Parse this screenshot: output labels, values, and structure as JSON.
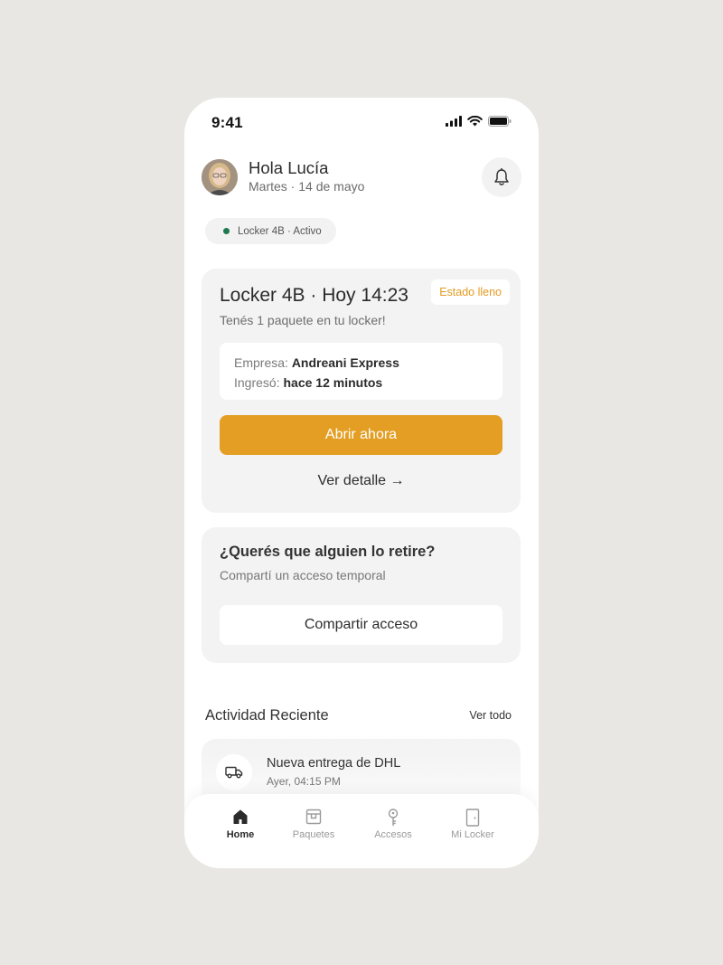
{
  "status_bar": {
    "time": "9:41"
  },
  "header": {
    "greeting": "Hola Lucía",
    "date": "Martes · 14 de mayo",
    "bell_icon": "bell-icon"
  },
  "status_chip": {
    "label": "Locker 4B · Activo",
    "dot_color": "#1d7a4e"
  },
  "locker_card": {
    "title": "Locker 4B · Hoy 14:23",
    "badge": "Estado lleno",
    "subtitle": "Tenés 1 paquete en tu locker!",
    "company_label": "Empresa:",
    "company_value": "Andreani Express",
    "entered_label": "Ingresó:",
    "entered_value": "hace 12 minutos",
    "primary_button": "Abrir ahora",
    "detail_link": "Ver detalle →"
  },
  "share_card": {
    "title": "¿Querés que alguien lo retire?",
    "subtitle": "Compartí un acceso temporal",
    "button": "Compartir acceso"
  },
  "activity": {
    "title": "Actividad Reciente",
    "see_all": "Ver todo",
    "items": [
      {
        "icon": "truck-icon",
        "title": "Nueva entrega de DHL",
        "time": "Ayer, 04:15 PM"
      }
    ]
  },
  "tabs": [
    {
      "label": "Home",
      "icon": "home-icon",
      "active": true
    },
    {
      "label": "Paquetes",
      "icon": "package-icon",
      "active": false
    },
    {
      "label": "Accesos",
      "icon": "key-icon",
      "active": false
    },
    {
      "label": "Mi Locker",
      "icon": "door-icon",
      "active": false
    }
  ],
  "colors": {
    "accent": "#e39e23",
    "badge_text": "#e39b21",
    "background": "#e8e7e3",
    "card": "#f3f3f3"
  }
}
